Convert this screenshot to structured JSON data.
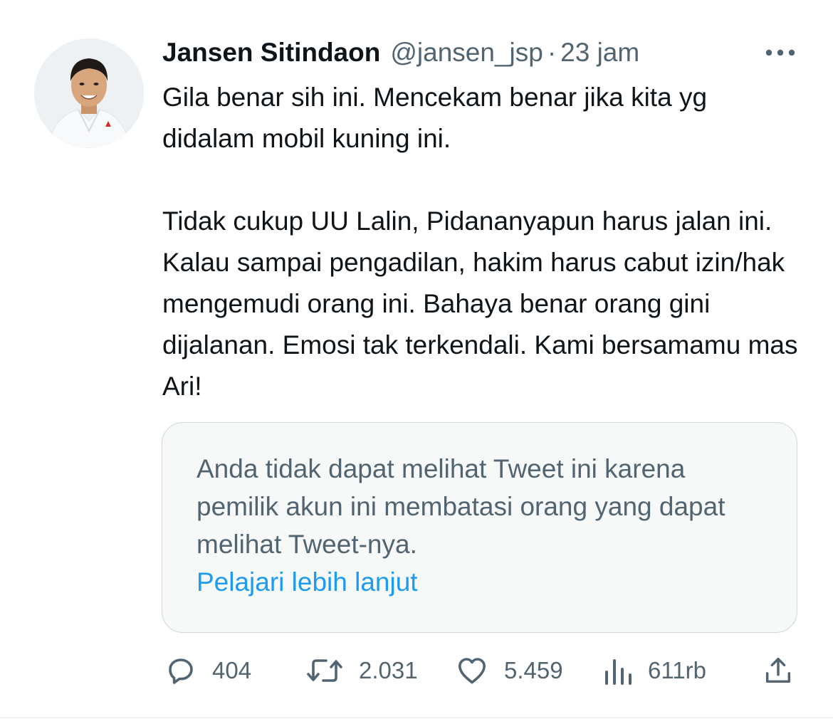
{
  "tweet": {
    "author_name": "Jansen Sitindaon",
    "author_handle": "@jansen_jsp",
    "separator": "·",
    "time": "23 jam",
    "paragraphs": [
      "Gila benar sih ini. Mencekam benar jika kita yg didalam mobil kuning ini.",
      "Tidak cukup UU Lalin, Pidananyapun harus jalan ini. Kalau sampai pengadilan, hakim harus cabut izin/hak mengemudi orang ini. Bahaya benar orang gini dijalanan. Emosi tak terkendali. Kami bersamamu mas Ari!"
    ]
  },
  "quoted_notice": {
    "message": "Anda tidak dapat melihat Tweet ini karena pemilik akun ini membatasi orang yang dapat melihat Tweet-nya.",
    "link_label": "Pelajari lebih lanjut"
  },
  "actions": {
    "replies": "404",
    "retweets": "2.031",
    "likes": "5.459",
    "views": "611rb"
  },
  "icons": {
    "more": "more-horizontal-icon",
    "reply": "reply-bubble-icon",
    "retweet": "retweet-icon",
    "like": "heart-icon",
    "views": "analytics-bars-icon",
    "share": "share-upload-icon"
  },
  "colors": {
    "text_primary": "#0f1419",
    "text_secondary": "#536471",
    "link": "#1d9bf0",
    "card_background": "#f7f9f9",
    "card_border": "#cfd9de"
  }
}
